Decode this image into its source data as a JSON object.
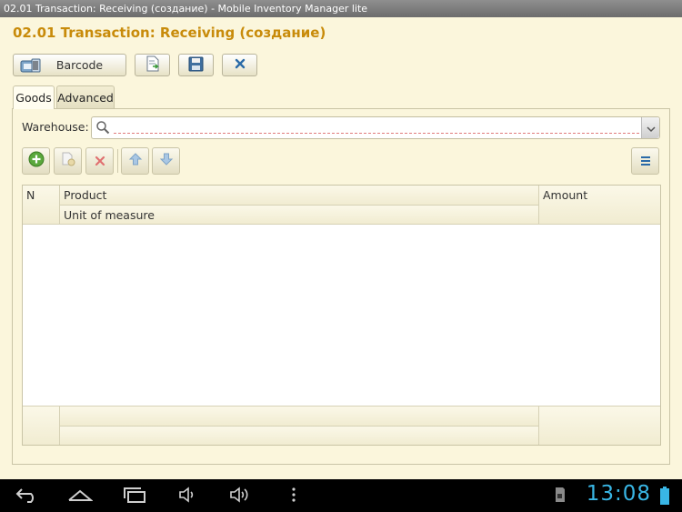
{
  "window": {
    "title": "02.01 Transaction: Receiving (создание) - Mobile Inventory Manager lite"
  },
  "form": {
    "title": "02.01 Transaction: Receiving (создание)"
  },
  "toolbar": {
    "barcode_label": "Barcode",
    "icons": [
      "barcode-icon",
      "document-arrow-icon",
      "save-icon",
      "close-icon"
    ]
  },
  "tabs": [
    {
      "label": "Goods",
      "active": true
    },
    {
      "label": "Advanced",
      "active": false
    }
  ],
  "warehouse": {
    "label": "Warehouse:",
    "value": "",
    "placeholder": ""
  },
  "table": {
    "columns": {
      "n": "N",
      "product": "Product",
      "unit": "Unit of measure",
      "amount": "Amount"
    },
    "rows": []
  },
  "status_bar": {
    "clock": "13:08"
  },
  "colors": {
    "accent": "#c88b0a",
    "background": "#fbf6dc",
    "clock": "#39b6e5"
  }
}
